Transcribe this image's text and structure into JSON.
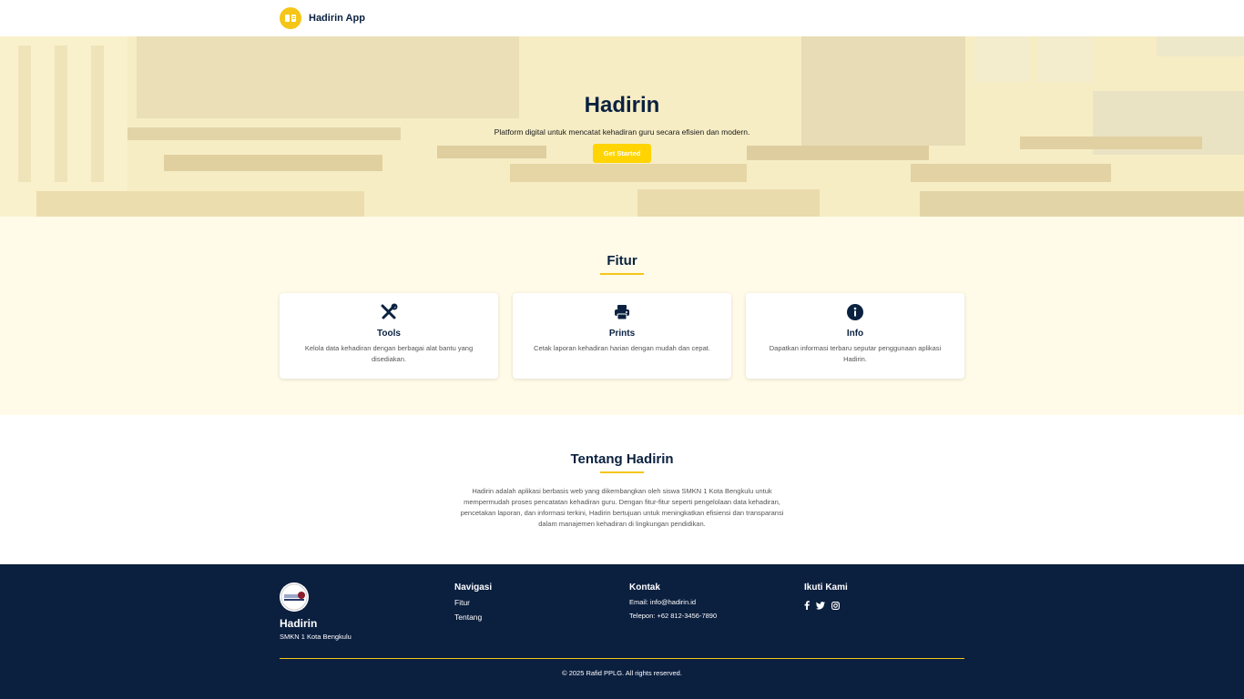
{
  "navbar": {
    "brand": "Hadirin App"
  },
  "hero": {
    "title": "Hadirin",
    "subtitle": "Platform digital untuk mencatat kehadiran guru secara efisien dan modern.",
    "cta": "Get Started"
  },
  "features": {
    "title": "Fitur",
    "items": [
      {
        "icon": "tools-icon",
        "title": "Tools",
        "desc": "Kelola data kehadiran dengan berbagai alat bantu yang disediakan."
      },
      {
        "icon": "printer-icon",
        "title": "Prints",
        "desc": "Cetak laporan kehadiran harian dengan mudah dan cepat."
      },
      {
        "icon": "info-icon",
        "title": "Info",
        "desc": "Dapatkan informasi terbaru seputar penggunaan aplikasi Hadirin."
      }
    ]
  },
  "about": {
    "title": "Tentang Hadirin",
    "text": "Hadirin adalah aplikasi berbasis web yang dikembangkan oleh siswa SMKN 1 Kota Bengkulu untuk mempermudah proses pencatatan kehadiran guru. Dengan fitur-fitur seperti pengelolaan data kehadiran, pencetakan laporan, dan informasi terkini, Hadirin bertujuan untuk meningkatkan efisiensi dan transparansi dalam manajemen kehadiran di lingkungan pendidikan."
  },
  "footer": {
    "brand": "Hadirin",
    "school": "SMKN 1 Kota Bengkulu",
    "nav_title": "Navigasi",
    "nav_links": [
      "Fitur",
      "Tentang"
    ],
    "contact_title": "Kontak",
    "email": "Email: info@hadirin.id",
    "phone": "Telepon: +62 812-3456-7890",
    "social_title": "Ikuti Kami",
    "social_icons": [
      "facebook-icon",
      "twitter-icon",
      "instagram-icon"
    ],
    "copyright": "© 2025 Rafid PPLG. All rights reserved."
  },
  "colors": {
    "accent": "#f5c518",
    "navy": "#0b1f3f",
    "cream": "#fffbe8",
    "button": "#ffd400"
  }
}
